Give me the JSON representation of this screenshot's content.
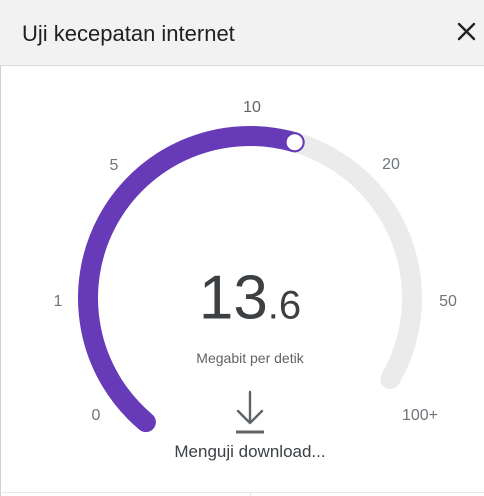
{
  "dialog": {
    "title": "Uji kecepatan internet",
    "close_icon": "close-icon"
  },
  "gauge": {
    "ticks": [
      "0",
      "1",
      "5",
      "10",
      "20",
      "50",
      "100+"
    ],
    "progress_fraction": 0.6,
    "speed_integer": "13",
    "speed_decimal": ".6",
    "unit": "Megabit per detik",
    "status_icon": "download-arrow-icon",
    "status": "Menguji download..."
  },
  "colors": {
    "progress": "#673ab7",
    "track": "#ebebeb",
    "header_bg": "#f2f2f2"
  }
}
